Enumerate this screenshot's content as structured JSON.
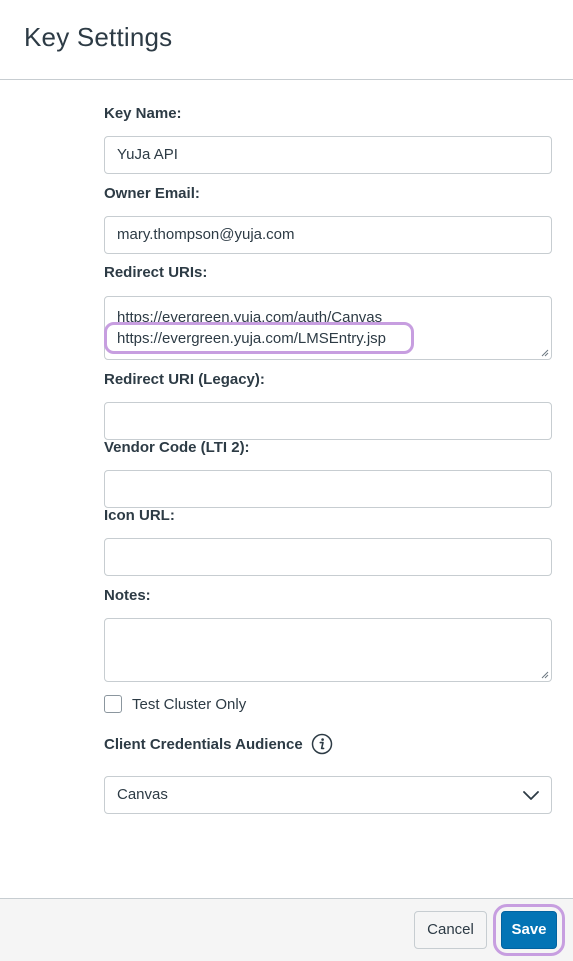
{
  "dialog": {
    "title": "Key Settings"
  },
  "form": {
    "key_name": {
      "label": "Key Name:",
      "value": "YuJa API"
    },
    "owner_email": {
      "label": "Owner Email:",
      "value": "mary.thompson@yuja.com"
    },
    "redirect_uris": {
      "label": "Redirect URIs:",
      "lines": [
        "https://evergreen.yuja.com/auth/Canvas",
        "https://evergreen.yuja.com/LMSEntry.jsp"
      ],
      "highlighted_line_index": 1
    },
    "redirect_uri_legacy": {
      "label": "Redirect URI (Legacy):",
      "value": ""
    },
    "vendor_code": {
      "label": "Vendor Code (LTI 2):",
      "value": ""
    },
    "icon_url": {
      "label": "Icon URL:",
      "value": ""
    },
    "notes": {
      "label": "Notes:",
      "value": ""
    },
    "test_cluster_only": {
      "label": "Test Cluster Only",
      "checked": false
    },
    "client_credentials_audience": {
      "label": "Client Credentials Audience",
      "info_icon": "info-icon",
      "selected": "Canvas"
    }
  },
  "footer": {
    "cancel_label": "Cancel",
    "save_label": "Save",
    "save_highlighted": true
  },
  "colors": {
    "primary": "#0374b5",
    "highlight": "#c79ee0",
    "border": "#c7cdd1",
    "text": "#2d3b45"
  }
}
